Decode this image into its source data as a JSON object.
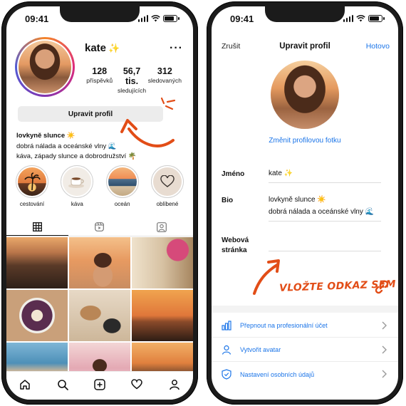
{
  "status": {
    "time": "09:41"
  },
  "profile": {
    "username": "kate",
    "username_emoji": "✨",
    "stats": [
      {
        "num": "128",
        "label": "příspěvků"
      },
      {
        "num": "56,7 tis.",
        "label": "sledujících"
      },
      {
        "num": "312",
        "label": "sledovaných"
      }
    ],
    "edit_button": "Upravit profil",
    "bio_name": "lovkyně slunce ☀️",
    "bio_lines": [
      "dobrá nálada a oceánské vlny 🌊",
      "káva, západy slunce a dobrodružství 🌴"
    ],
    "highlights": [
      {
        "label": "cestování",
        "icon": "palm-sunset"
      },
      {
        "label": "káva",
        "icon": "coffee-cup"
      },
      {
        "label": "oceán",
        "icon": "ocean-waves"
      },
      {
        "label": "oblíbené",
        "icon": "heart-outline"
      }
    ],
    "grid_photos": [
      "beach-restaurant",
      "woman-beach-sunset",
      "street-flowers",
      "acai-bowl",
      "iced-coffee-camera",
      "palm-sunset",
      "coastal-town",
      "woman-flowers",
      "sunset-dinner"
    ]
  },
  "edit": {
    "cancel": "Zrušit",
    "title": "Upravit profil",
    "done": "Hotovo",
    "change_photo": "Změnit profilovou fotku",
    "name_label": "Jméno",
    "name_value": "kate ✨",
    "bio_label": "Bio",
    "bio_line1": "lovkyně slunce ☀️",
    "bio_line2": "dobrá nálada a oceánské vlny 🌊",
    "website_label_1": "Webová",
    "website_label_2": "stránka",
    "website_value": "",
    "hint": "VLOŽTE ODKAZ SEM",
    "menu": [
      {
        "label": "Přepnout na profesionální účet",
        "icon": "bar-chart-icon"
      },
      {
        "label": "Vytvořit avatar",
        "icon": "person-icon"
      },
      {
        "label": "Nastavení osobních údajů",
        "icon": "shield-icon"
      }
    ]
  },
  "colors": {
    "accent_blue": "#1a74e8",
    "accent_orange": "#e24d17"
  }
}
